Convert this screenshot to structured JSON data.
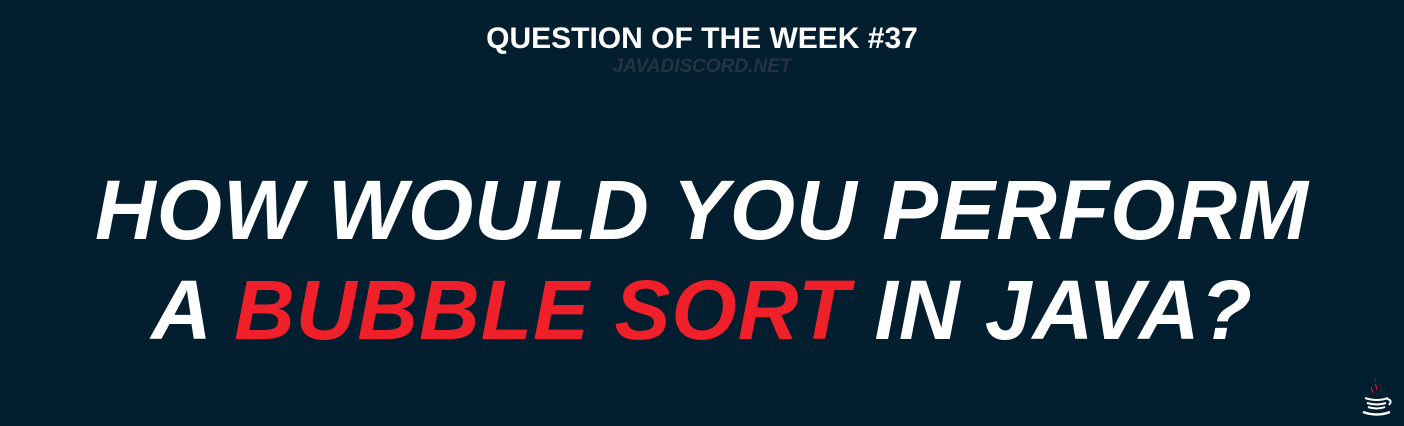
{
  "header": {
    "title": "QUESTION OF THE WEEK #37",
    "subtitle": "JAVADISCORD.NET"
  },
  "headline": {
    "line1": "HOW WOULD YOU PERFORM",
    "line2_before": "A ",
    "line2_accent": "BUBBLE SORT",
    "line2_after": " IN JAVA?"
  },
  "colors": {
    "background": "#031e2f",
    "accent": "#f0202a",
    "subtitle": "#253443"
  },
  "logo": {
    "icon": "java-coffee-cup-icon"
  }
}
